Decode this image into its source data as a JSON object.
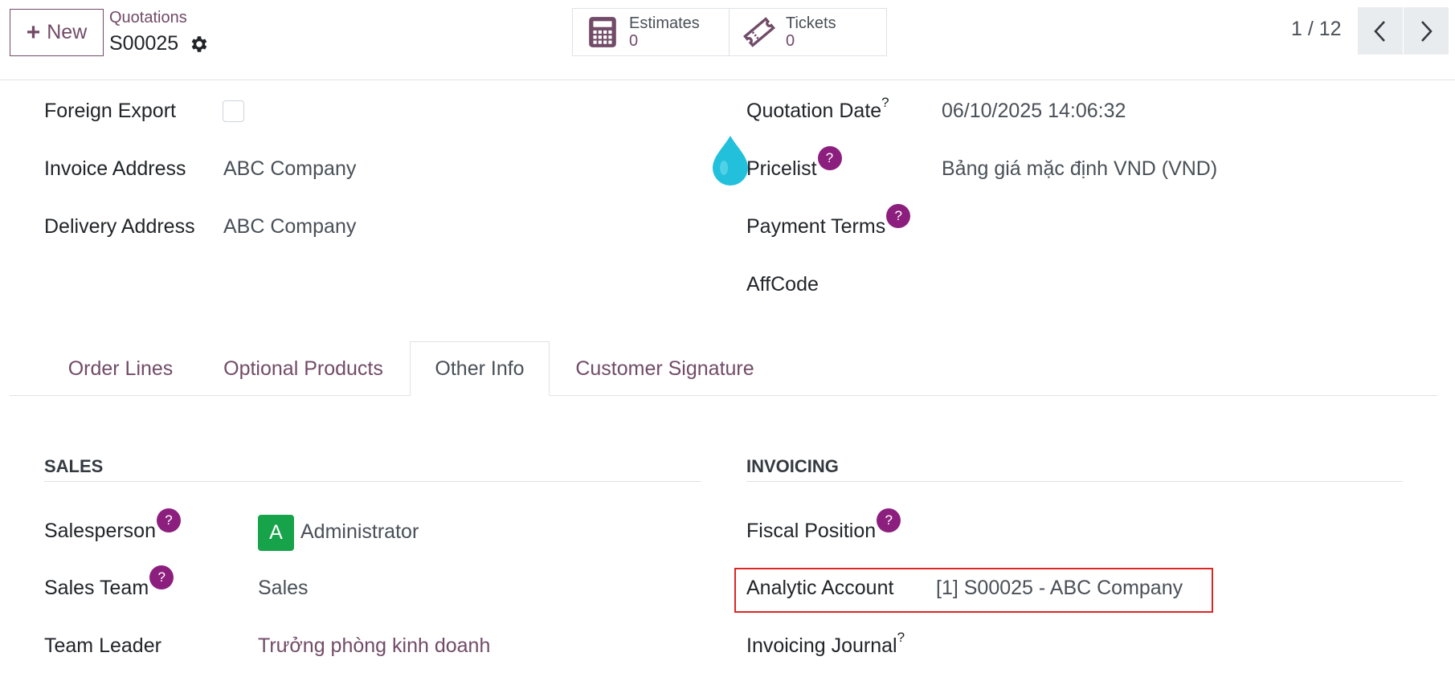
{
  "header": {
    "new_label": "New",
    "breadcrumb": "Quotations",
    "record_name": "S00025",
    "smart_buttons": [
      {
        "label": "Estimates",
        "value": "0",
        "icon": "calculator-icon"
      },
      {
        "label": "Tickets",
        "value": "0",
        "icon": "ticket-icon"
      }
    ],
    "pager": "1 / 12"
  },
  "form": {
    "foreign_export_label": "Foreign Export",
    "invoice_address_label": "Invoice Address",
    "invoice_address_value": "ABC Company",
    "delivery_address_label": "Delivery Address",
    "delivery_address_value": "ABC Company",
    "quotation_date_label": "Quotation Date",
    "quotation_date_value": "06/10/2025 14:06:32",
    "pricelist_label": "Pricelist",
    "pricelist_value": "Bảng giá mặc định VND  (VND)",
    "payment_terms_label": "Payment Terms",
    "affcode_label": "AffCode",
    "help_mark": "?"
  },
  "tabs": [
    {
      "label": "Order Lines",
      "active": false
    },
    {
      "label": "Optional Products",
      "active": false
    },
    {
      "label": "Other Info",
      "active": true
    },
    {
      "label": "Customer Signature",
      "active": false
    }
  ],
  "other_info": {
    "sales_title": "SALES",
    "salesperson_label": "Salesperson",
    "salesperson_avatar": "A",
    "salesperson_value": "Administrator",
    "sales_team_label": "Sales Team",
    "sales_team_value": "Sales",
    "team_leader_label": "Team Leader",
    "team_leader_value": "Trưởng phòng kinh doanh",
    "invoicing_title": "INVOICING",
    "fiscal_position_label": "Fiscal Position",
    "analytic_account_label": "Analytic Account",
    "analytic_account_value": "[1] S00025 - ABC Company",
    "invoicing_journal_label": "Invoicing Journal"
  },
  "colors": {
    "brand": "#714B67",
    "help_badge": "#8c1f7e",
    "avatar": "#16a34a",
    "highlight": "#dc2626"
  }
}
